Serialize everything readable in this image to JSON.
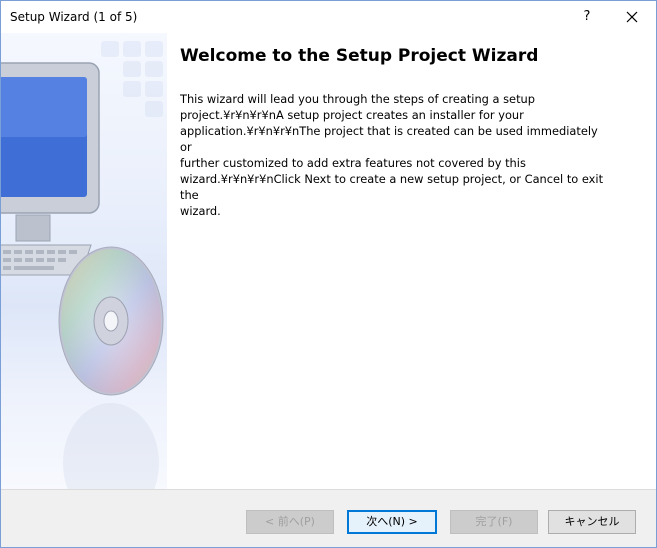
{
  "window": {
    "title": "Setup Wizard (1 of 5)",
    "help_label": "?"
  },
  "main": {
    "heading": "Welcome to the Setup Project Wizard",
    "body": "This wizard will lead you through the steps of creating a setup\nproject.¥r¥n¥r¥nA setup project creates an installer for your\napplication.¥r¥n¥r¥nThe project that is created can be used immediately or\nfurther customized to add extra features not covered by this\nwizard.¥r¥n¥r¥nClick Next to create a new setup project, or Cancel to exit the\nwizard."
  },
  "buttons": {
    "back": "< 前へ(P)",
    "next": "次へ(N) >",
    "finish": "完了(F)",
    "cancel": "キャンセル"
  },
  "colors": {
    "accent": "#0078d7",
    "footer_bg": "#f0f0f0",
    "side_panel": "#e8eefb"
  },
  "icons": [
    "help-icon",
    "close-icon",
    "computer-icon",
    "cd-disc-icon"
  ]
}
